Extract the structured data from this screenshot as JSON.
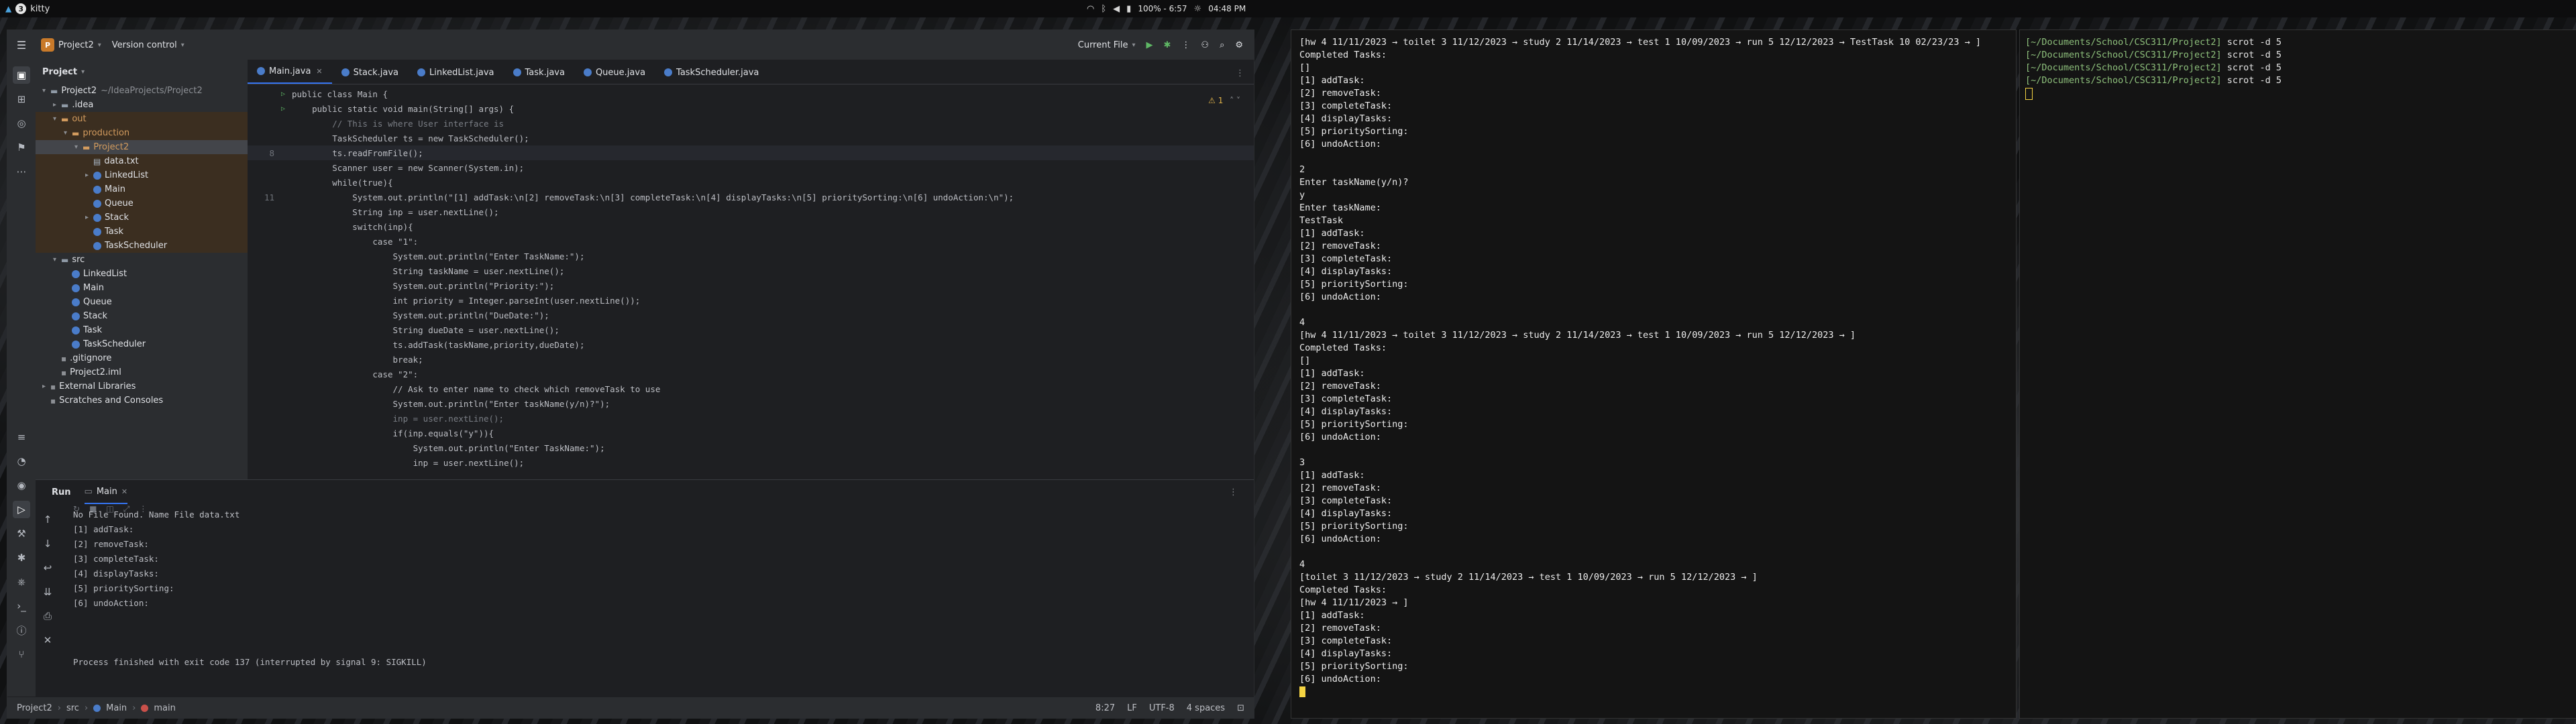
{
  "topbar": {
    "workspace_number": "3",
    "app_title": "kitty",
    "brightness_status": "100% - 6:57",
    "clock": "04:48 PM"
  },
  "ide": {
    "project_name": "Project2",
    "project_badge": "P",
    "version_control": "Version control",
    "run_config": "Current File",
    "project_panel_title": "Project",
    "tree": [
      {
        "label": "Project2",
        "hint": "~/IdeaProjects/Project2",
        "icon": "folder-icon",
        "depth": 0,
        "arrow": "▾"
      },
      {
        "label": ".idea",
        "hint": "",
        "icon": "folder-icon",
        "depth": 1,
        "arrow": "▸"
      },
      {
        "label": "out",
        "hint": "",
        "icon": "folder-orange-icon",
        "depth": 1,
        "arrow": "▾"
      },
      {
        "label": "production",
        "hint": "",
        "icon": "folder-orange-icon",
        "depth": 2,
        "arrow": "▾"
      },
      {
        "label": "Project2",
        "hint": "",
        "icon": "folder-orange-icon",
        "depth": 3,
        "arrow": "▾"
      },
      {
        "label": "data.txt",
        "hint": "",
        "icon": "text-file-icon",
        "depth": 4,
        "arrow": ""
      },
      {
        "label": "LinkedList",
        "hint": "",
        "icon": "class-icon",
        "depth": 4,
        "arrow": "▸"
      },
      {
        "label": "Main",
        "hint": "",
        "icon": "class-icon",
        "depth": 4,
        "arrow": ""
      },
      {
        "label": "Queue",
        "hint": "",
        "icon": "class-icon",
        "depth": 4,
        "arrow": ""
      },
      {
        "label": "Stack",
        "hint": "",
        "icon": "class-icon",
        "depth": 4,
        "arrow": "▸"
      },
      {
        "label": "Task",
        "hint": "",
        "icon": "class-icon",
        "depth": 4,
        "arrow": ""
      },
      {
        "label": "TaskScheduler",
        "hint": "",
        "icon": "class-icon",
        "depth": 4,
        "arrow": ""
      },
      {
        "label": "src",
        "hint": "",
        "icon": "folder-icon",
        "depth": 1,
        "arrow": "▾"
      },
      {
        "label": "LinkedList",
        "hint": "",
        "icon": "class-icon",
        "depth": 2,
        "arrow": ""
      },
      {
        "label": "Main",
        "hint": "",
        "icon": "class-icon",
        "depth": 2,
        "arrow": ""
      },
      {
        "label": "Queue",
        "hint": "",
        "icon": "class-icon",
        "depth": 2,
        "arrow": ""
      },
      {
        "label": "Stack",
        "hint": "",
        "icon": "class-icon",
        "depth": 2,
        "arrow": ""
      },
      {
        "label": "Task",
        "hint": "",
        "icon": "class-icon",
        "depth": 2,
        "arrow": ""
      },
      {
        "label": "TaskScheduler",
        "hint": "",
        "icon": "class-icon",
        "depth": 2,
        "arrow": ""
      },
      {
        "label": ".gitignore",
        "hint": "",
        "icon": "gitignore-icon",
        "depth": 1,
        "arrow": ""
      },
      {
        "label": "Project2.iml",
        "hint": "",
        "icon": "module-file-icon",
        "depth": 1,
        "arrow": ""
      },
      {
        "label": "External Libraries",
        "hint": "",
        "icon": "library-icon",
        "depth": 0,
        "arrow": "▸"
      },
      {
        "label": "Scratches and Consoles",
        "hint": "",
        "icon": "scratches-icon",
        "depth": 0,
        "arrow": ""
      }
    ],
    "tabs": [
      "Main.java",
      "Stack.java",
      "LinkedList.java",
      "Task.java",
      "Queue.java",
      "TaskScheduler.java"
    ],
    "warnings_count": "1",
    "code_lines": [
      {
        "n": "",
        "t": "public class Main {"
      },
      {
        "n": "",
        "t": "    public static void main(String[] args) {"
      },
      {
        "n": "",
        "t": "        // This is where User interface is"
      },
      {
        "n": "",
        "t": "        TaskScheduler ts = new TaskScheduler();"
      },
      {
        "n": "8",
        "t": "        ts.readFromFile();"
      },
      {
        "n": "",
        "t": "        Scanner user = new Scanner(System.in);"
      },
      {
        "n": "",
        "t": "        while(true){"
      },
      {
        "n": "11",
        "t": "            System.out.println(\"[1] addTask:\\n[2] removeTask:\\n[3] completeTask:\\n[4] displayTasks:\\n[5] prioritySorting:\\n[6] undoAction:\\n\");"
      },
      {
        "n": "",
        "t": "            String inp = user.nextLine();"
      },
      {
        "n": "",
        "t": "            switch(inp){"
      },
      {
        "n": "",
        "t": "                case \"1\":"
      },
      {
        "n": "",
        "t": "                    System.out.println(\"Enter TaskName:\");"
      },
      {
        "n": "",
        "t": "                    String taskName = user.nextLine();"
      },
      {
        "n": "",
        "t": "                    System.out.println(\"Priority:\");"
      },
      {
        "n": "",
        "t": "                    int priority = Integer.parseInt(user.nextLine());"
      },
      {
        "n": "",
        "t": "                    System.out.println(\"DueDate:\");"
      },
      {
        "n": "",
        "t": "                    String dueDate = user.nextLine();"
      },
      {
        "n": "",
        "t": "                    ts.addTask(taskName,priority,dueDate);"
      },
      {
        "n": "",
        "t": "                    break;"
      },
      {
        "n": "",
        "t": "                case \"2\":"
      },
      {
        "n": "",
        "t": "                    // Ask to enter name to check which removeTask to use"
      },
      {
        "n": "",
        "t": "                    System.out.println(\"Enter taskName(y/n)?\");"
      },
      {
        "n": "",
        "t": "                    inp = user.nextLine();"
      },
      {
        "n": "",
        "t": "                    if(inp.equals(\"y\")){"
      },
      {
        "n": "",
        "t": "                        System.out.println(\"Enter TaskName:\");"
      },
      {
        "n": "",
        "t": "                        inp = user.nextLine();"
      }
    ],
    "run_tab_label": "Run",
    "run_config_tab": "Main",
    "run_output": [
      "No File Found. Name File data.txt",
      "[1] addTask:",
      "[2] removeTask:",
      "[3] completeTask:",
      "[4] displayTasks:",
      "[5] prioritySorting:",
      "[6] undoAction:",
      "",
      "",
      "",
      "Process finished with exit code 137 (interrupted by signal 9: SIGKILL)"
    ],
    "status": {
      "crumb_project": "Project2",
      "crumb_src": "src",
      "crumb_class": "Main",
      "crumb_method": "main",
      "position": "8:27",
      "line_ending": "LF",
      "encoding": "UTF-8",
      "indent": "4 spaces"
    }
  },
  "terminal_main": [
    "[hw 4 11/11/2023 → toilet 3 11/12/2023 → study 2 11/14/2023 → test 1 10/09/2023 → run 5 12/12/2023 → TestTask 10 02/23/23 → ]",
    "Completed Tasks:",
    "[]",
    "[1] addTask:",
    "[2] removeTask:",
    "[3] completeTask:",
    "[4] displayTasks:",
    "[5] prioritySorting:",
    "[6] undoAction:",
    "",
    "2",
    "Enter taskName(y/n)?",
    "y",
    "Enter taskName:",
    "TestTask",
    "[1] addTask:",
    "[2] removeTask:",
    "[3] completeTask:",
    "[4] displayTasks:",
    "[5] prioritySorting:",
    "[6] undoAction:",
    "",
    "4",
    "[hw 4 11/11/2023 → toilet 3 11/12/2023 → study 2 11/14/2023 → test 1 10/09/2023 → run 5 12/12/2023 → ]",
    "Completed Tasks:",
    "[]",
    "[1] addTask:",
    "[2] removeTask:",
    "[3] completeTask:",
    "[4] displayTasks:",
    "[5] prioritySorting:",
    "[6] undoAction:",
    "",
    "3",
    "[1] addTask:",
    "[2] removeTask:",
    "[3] completeTask:",
    "[4] displayTasks:",
    "[5] prioritySorting:",
    "[6] undoAction:",
    "",
    "4",
    "[toilet 3 11/12/2023 → study 2 11/14/2023 → test 1 10/09/2023 → run 5 12/12/2023 → ]",
    "Completed Tasks:",
    "[hw 4 11/11/2023 → ]",
    "[1] addTask:",
    "[2] removeTask:",
    "[3] completeTask:",
    "[4] displayTasks:",
    "[5] prioritySorting:",
    "[6] undoAction:"
  ],
  "terminal_side": {
    "prompt": "[~/Documents/School/CSC311/Project2]",
    "commands": [
      "scrot -d 5",
      "scrot -d 5",
      "scrot -d 5",
      "scrot -d 5"
    ]
  },
  "colors": {
    "accent": "#3574f0",
    "prompt_green": "#8ec07c",
    "cursor": "#f5d442"
  }
}
